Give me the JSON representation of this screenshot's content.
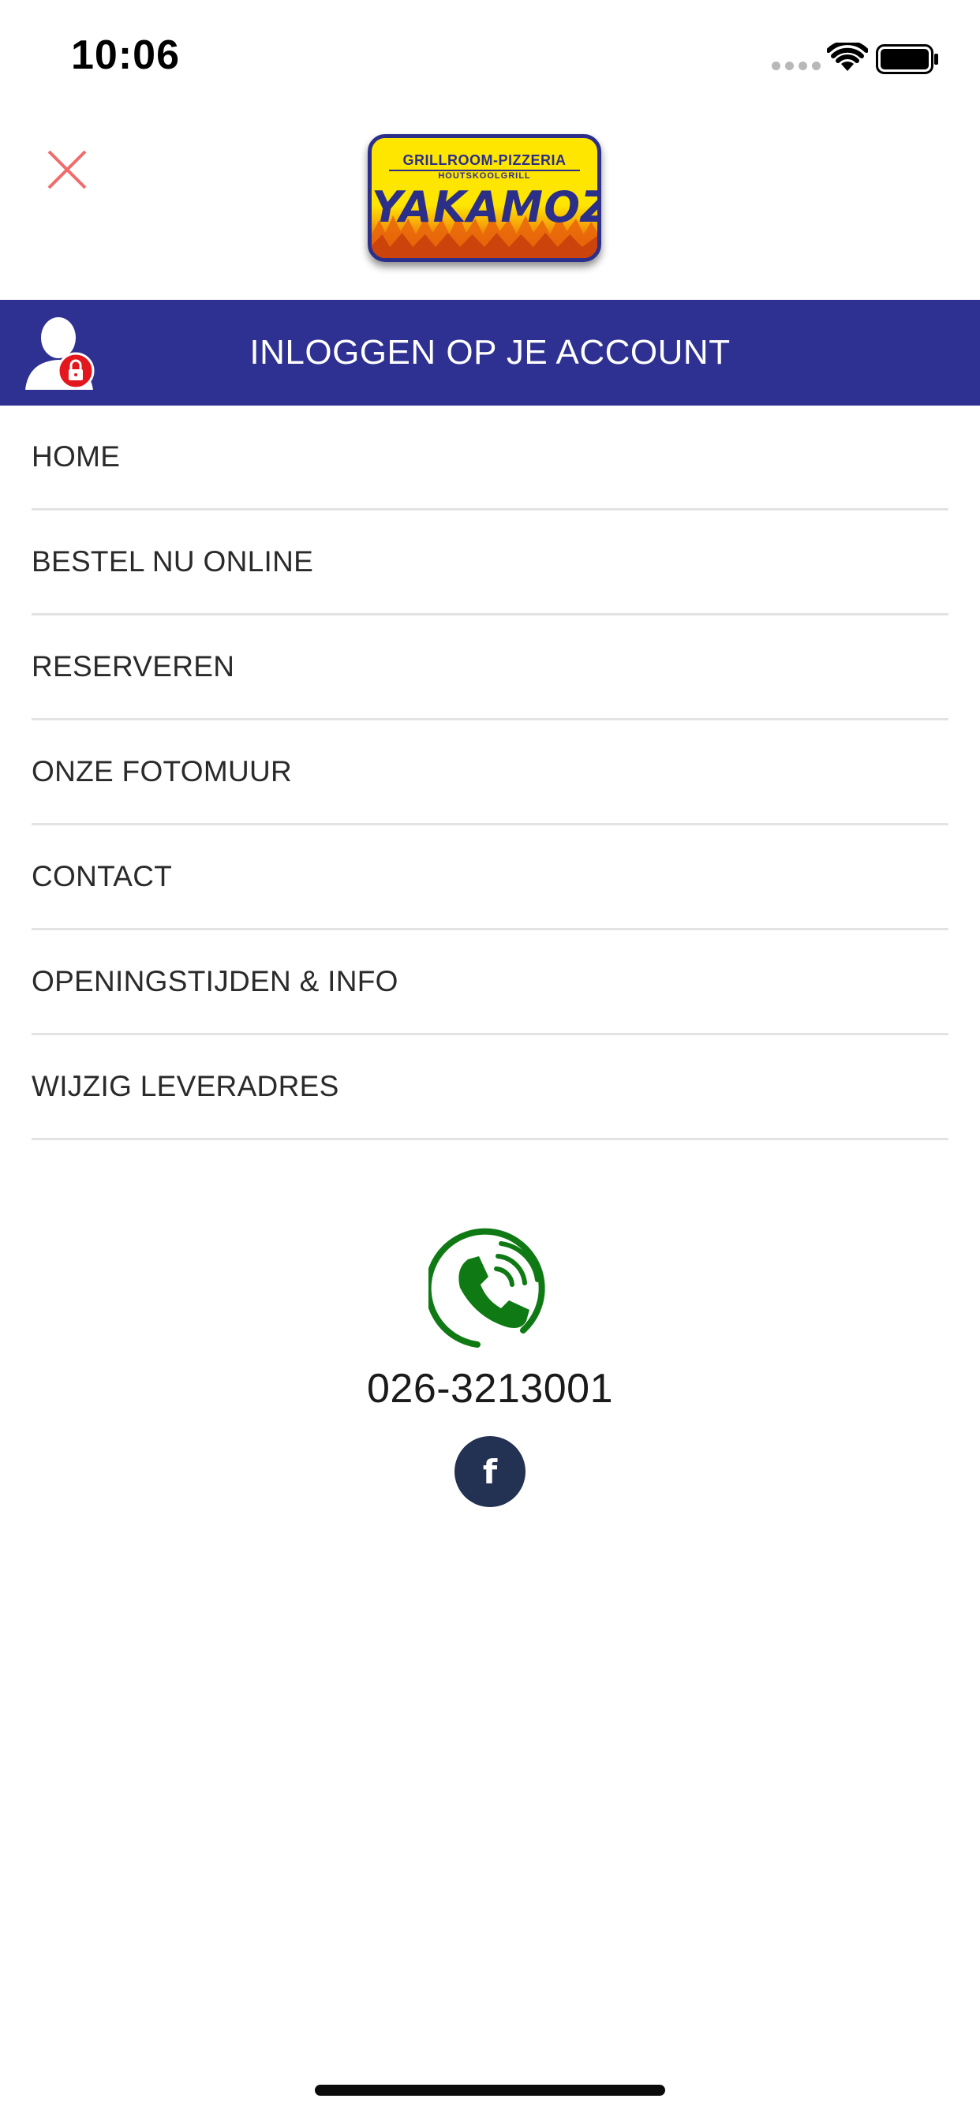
{
  "status_bar": {
    "time": "10:06",
    "icons": [
      "signal-dots-icon",
      "wifi-icon",
      "battery-icon"
    ]
  },
  "header": {
    "close_icon": "close-icon",
    "close_color": "#f26b6b",
    "logo": {
      "line1": "GRILLROOM-PIZZERIA",
      "line2": "HOUTSKOOLGRILL",
      "brand": "YAKAMOZ"
    }
  },
  "login_banner": {
    "label": "INLOGGEN OP JE ACCOUNT",
    "icon": "user-lock-icon",
    "background": "#2e3192"
  },
  "menu": {
    "items": [
      {
        "label": "HOME"
      },
      {
        "label": "BESTEL NU ONLINE"
      },
      {
        "label": "RESERVEREN"
      },
      {
        "label": "ONZE FOTOMUUR"
      },
      {
        "label": "CONTACT"
      },
      {
        "label": "OPENINGSTIJDEN & INFO"
      },
      {
        "label": "WIJZIG LEVERADRES"
      }
    ]
  },
  "contact": {
    "phone_icon": "phone-icon",
    "phone_color": "#0f7a14",
    "phone_number": "026-3213001",
    "facebook_icon": "facebook-icon",
    "facebook_glyph": "f",
    "facebook_color": "#233152"
  }
}
